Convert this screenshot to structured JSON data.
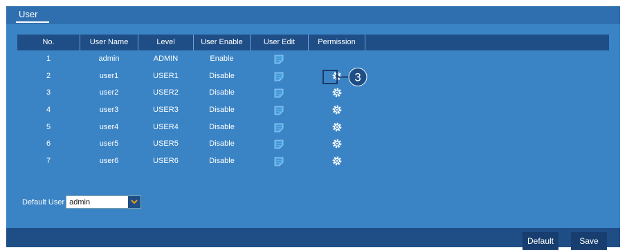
{
  "tab": {
    "label": "User"
  },
  "table": {
    "headers": [
      "No.",
      "User Name",
      "Level",
      "User Enable",
      "User Edit",
      "Permission"
    ],
    "rows": [
      {
        "no": "1",
        "name": "admin",
        "level": "ADMIN",
        "enable": "Enable"
      },
      {
        "no": "2",
        "name": "user1",
        "level": "USER1",
        "enable": "Disable"
      },
      {
        "no": "3",
        "name": "user2",
        "level": "USER2",
        "enable": "Disable"
      },
      {
        "no": "4",
        "name": "user3",
        "level": "USER3",
        "enable": "Disable"
      },
      {
        "no": "5",
        "name": "user4",
        "level": "USER4",
        "enable": "Disable"
      },
      {
        "no": "6",
        "name": "user5",
        "level": "USER5",
        "enable": "Disable"
      },
      {
        "no": "7",
        "name": "user6",
        "level": "USER6",
        "enable": "Disable"
      }
    ]
  },
  "callout": {
    "number": "3"
  },
  "default_user": {
    "label": "Default User",
    "value": "admin"
  },
  "buttons": {
    "default": "Default",
    "save": "Save"
  },
  "icons": {
    "edit": "edit-pencil-icon",
    "permission": "gear-icon",
    "dropdown": "chevron-down-icon"
  },
  "colors": {
    "panel": "#3a84c6",
    "header": "#1f4e86",
    "accent": "#e8a21a"
  }
}
